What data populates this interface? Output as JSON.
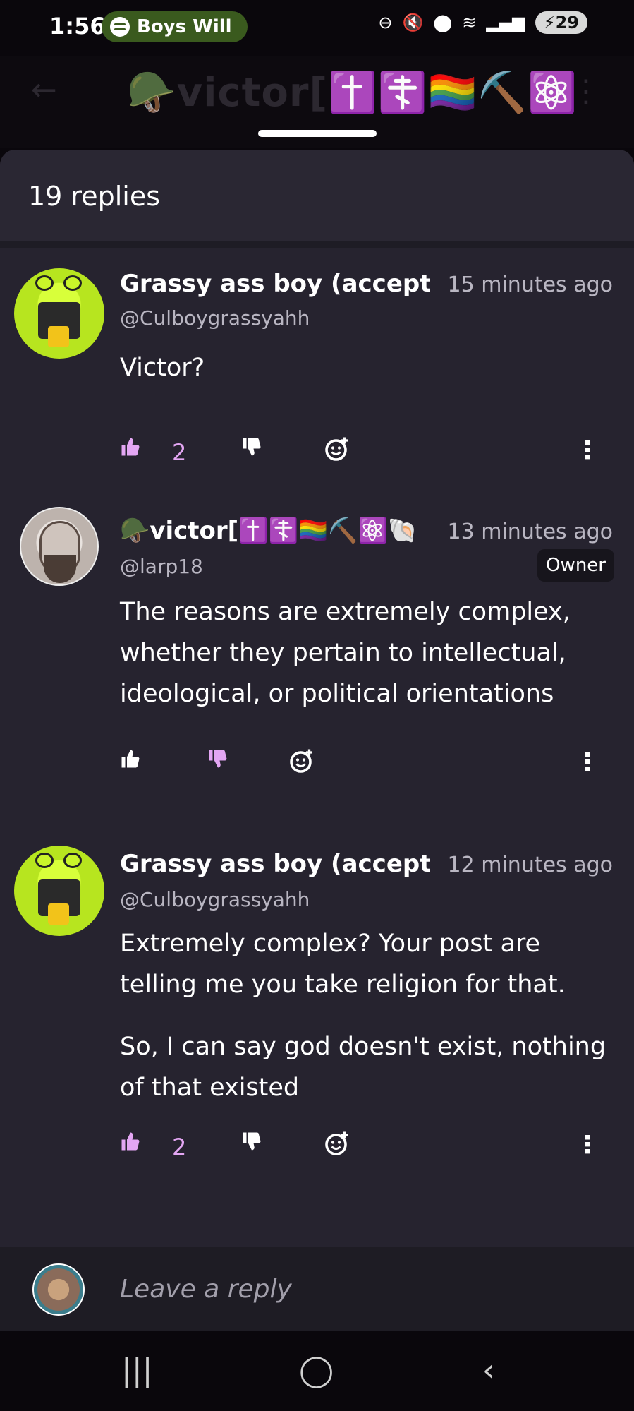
{
  "status_bar": {
    "time": "1:56",
    "media_text": "Boys Will",
    "battery": "29",
    "icons": [
      "dnd-icon",
      "mute-icon",
      "location-icon",
      "wifi-icon",
      "signal-icon"
    ]
  },
  "background_header": {
    "title": "🪖victor[✝️☦️🏳️‍🌈⛏️⚛️"
  },
  "sheet": {
    "title": "19 replies"
  },
  "comments": [
    {
      "name": "Grassy ass boy (accept",
      "time": "15 minutes ago",
      "handle": "@Culboygrassyahh",
      "text": [
        "Victor?"
      ],
      "likes": "2"
    },
    {
      "name": "🪖victor[✝️☦️🏳️‍🌈⛏️⚛️🐚",
      "time": "13 minutes ago",
      "handle": "@larp18",
      "badge": "Owner",
      "text": [
        "The reasons are extremely complex, whether they pertain to intellectual, ideological, or political orientations"
      ],
      "likes": ""
    },
    {
      "name": "Grassy ass boy (accept",
      "time": "12 minutes ago",
      "handle": "@Culboygrassyahh",
      "text": [
        "Extremely complex? Your post are telling me you take religion for that.",
        "So, I can say god doesn't exist, nothing of that existed"
      ],
      "likes": "2"
    }
  ],
  "reply_bar": {
    "placeholder": "Leave a reply"
  },
  "colors": {
    "sheet_bg": "#26232f",
    "like_accent": "#e3a6f3",
    "muted_text": "#b9b6c2"
  }
}
